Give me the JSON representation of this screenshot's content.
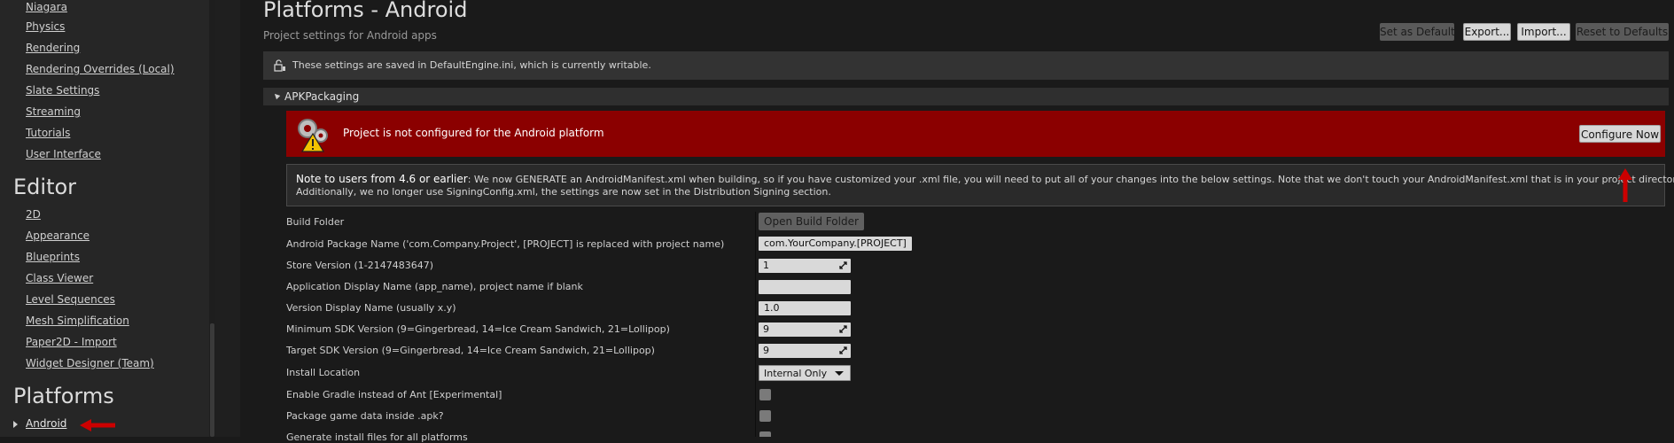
{
  "sidebar": {
    "project_items": [
      {
        "label": "Niagara",
        "top": -1
      },
      {
        "label": "Physics"
      },
      {
        "label": "Rendering"
      },
      {
        "label": "Rendering Overrides (Local)"
      },
      {
        "label": "Slate Settings"
      },
      {
        "label": "Streaming"
      },
      {
        "label": "Tutorials"
      },
      {
        "label": "User Interface"
      }
    ],
    "editor_heading": "Editor",
    "editor_items": [
      {
        "label": "2D"
      },
      {
        "label": "Appearance"
      },
      {
        "label": "Blueprints"
      },
      {
        "label": "Class Viewer"
      },
      {
        "label": "Level Sequences"
      },
      {
        "label": "Mesh Simplification"
      },
      {
        "label": "Paper2D - Import"
      },
      {
        "label": "Widget Designer (Team)"
      }
    ],
    "platforms_heading": "Platforms",
    "selected_item": "Android"
  },
  "header": {
    "title": "Platforms - Android",
    "subtitle": "Project settings for Android apps",
    "buttons": {
      "set_default": "Set as Default",
      "export": "Export...",
      "import": "Import...",
      "reset": "Reset to Defaults"
    }
  },
  "info_bar": {
    "text": "These settings are saved in DefaultEngine.ini, which is currently writable."
  },
  "category": {
    "name": "APKPackaging"
  },
  "warning": {
    "text": "Project is not configured for the Android platform",
    "button": "Configure Now",
    "color": "#8b0000"
  },
  "note": {
    "strong": "Note to users from 4.6 or earlier",
    "line1": ": We now GENERATE an AndroidManifest.xml when building, so if you have customized your .xml file, you will need to put all of your changes into the below settings. Note that we don't touch your AndroidManifest.xml that is in your project directory.",
    "line2": "Additionally, we no longer use SigningConfig.xml, the settings are now set in the Distribution Signing section."
  },
  "properties": {
    "build_folder": {
      "label": "Build Folder",
      "button": "Open Build Folder"
    },
    "package_name": {
      "label": "Android Package Name ('com.Company.Project', [PROJECT] is replaced with project name)",
      "value": "com.YourCompany.[PROJECT]"
    },
    "store_version": {
      "label": "Store Version (1-2147483647)",
      "value": "1"
    },
    "app_name": {
      "label": "Application Display Name (app_name), project name if blank",
      "value": ""
    },
    "version_display": {
      "label": "Version Display Name (usually x.y)",
      "value": "1.0"
    },
    "min_sdk": {
      "label": "Minimum SDK Version (9=Gingerbread, 14=Ice Cream Sandwich, 21=Lollipop)",
      "value": "9"
    },
    "target_sdk": {
      "label": "Target SDK Version (9=Gingerbread, 14=Ice Cream Sandwich, 21=Lollipop)",
      "value": "9"
    },
    "install_location": {
      "label": "Install Location",
      "value": "Internal Only"
    },
    "enable_gradle": {
      "label": "Enable Gradle instead of Ant [Experimental]",
      "checked": false
    },
    "package_data": {
      "label": "Package game data inside .apk?",
      "checked": false
    },
    "generate_install": {
      "label": "Generate install files for all platforms",
      "checked": false
    }
  },
  "colors": {
    "annotation_arrow": "#cc0000",
    "background": "#1a1a1a",
    "sidebar": "#262626"
  }
}
